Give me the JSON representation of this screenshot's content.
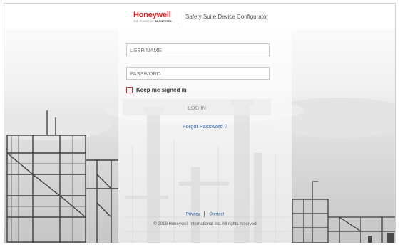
{
  "header": {
    "logo_word": "Honeywell",
    "logo_tagline_prefix": "THE POWER OF",
    "logo_tagline_bold": "CONNECTED",
    "app_title": "Safety Suite Device Configurator"
  },
  "login": {
    "username_placeholder": "USER NAME",
    "password_placeholder": "PASSWORD",
    "keep_signed_in_label": "Keep me signed in",
    "keep_signed_in_checked": false,
    "login_button_label": "LOG IN",
    "forgot_password_label": "Forgot Password ?"
  },
  "footer": {
    "privacy_label": "Privacy",
    "contact_label": "Contact",
    "copyright": "© 2019 Honeywell International Inc. All rights reserved"
  },
  "colors": {
    "brand_red": "#e31b23",
    "link_blue": "#2f66ad",
    "checkbox_border": "#c0302a"
  }
}
